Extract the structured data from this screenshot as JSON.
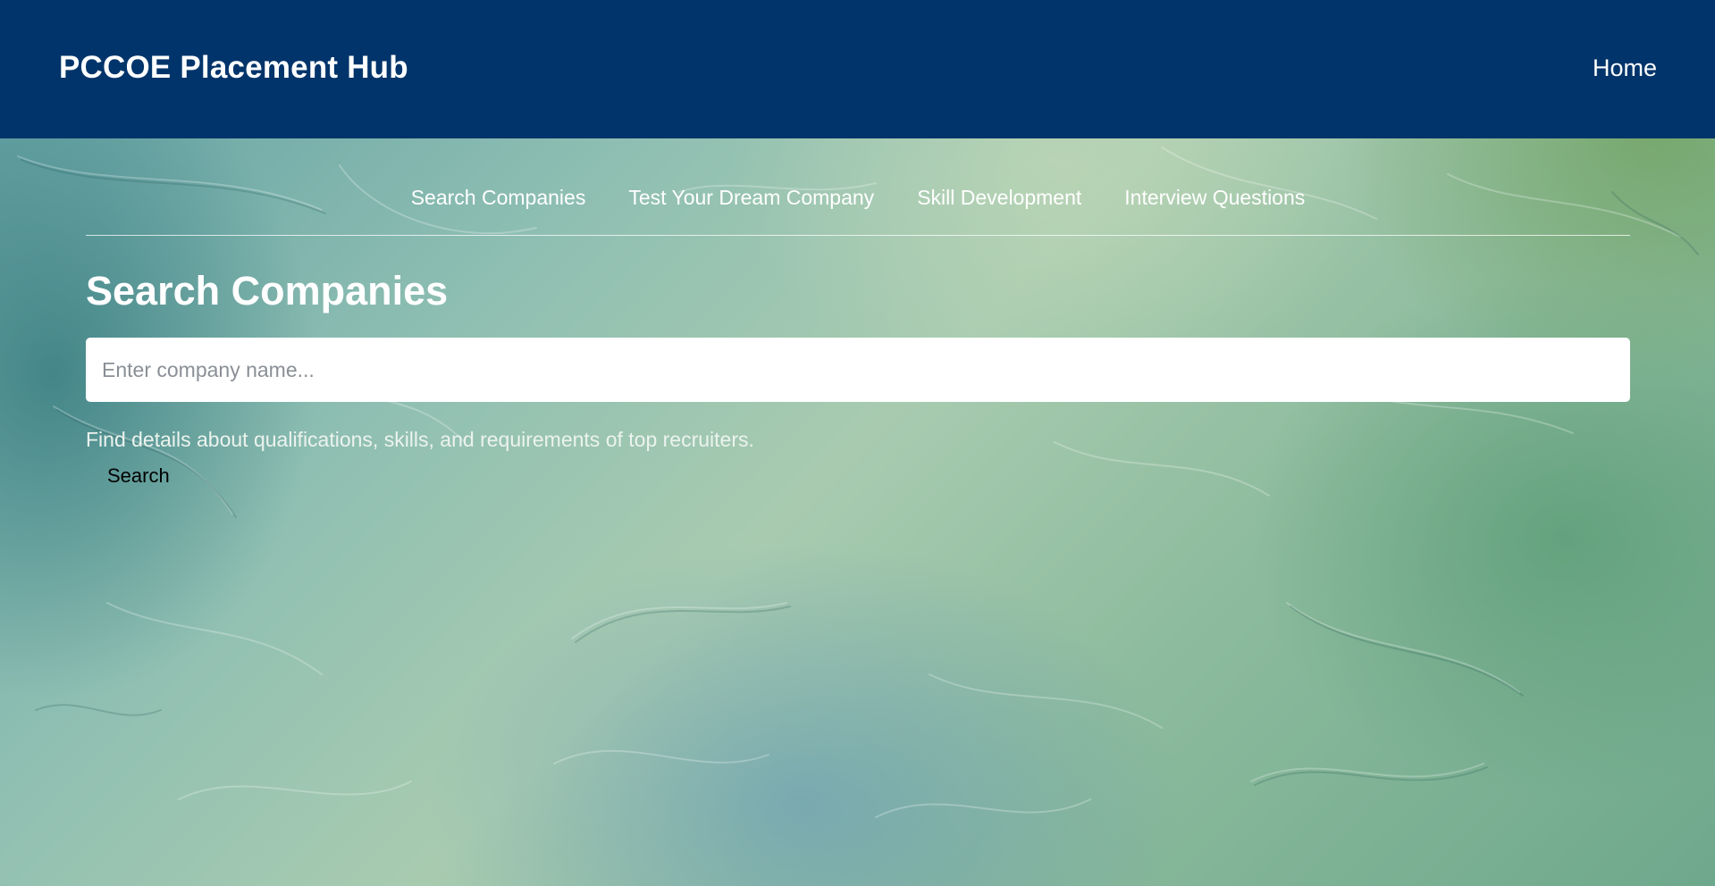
{
  "header": {
    "brand": "PCCOE Placement Hub",
    "nav": {
      "home_label": "Home"
    },
    "background_color": "#00346a"
  },
  "subnav": {
    "items": [
      {
        "label": "Search Companies"
      },
      {
        "label": "Test Your Dream Company"
      },
      {
        "label": "Skill Development"
      },
      {
        "label": "Interview Questions"
      }
    ]
  },
  "main": {
    "title": "Search Companies",
    "search": {
      "placeholder": "Enter company name...",
      "value": ""
    },
    "description": "Find details about qualifications, skills, and requirements of top recruiters.",
    "search_button_label": "Search"
  }
}
